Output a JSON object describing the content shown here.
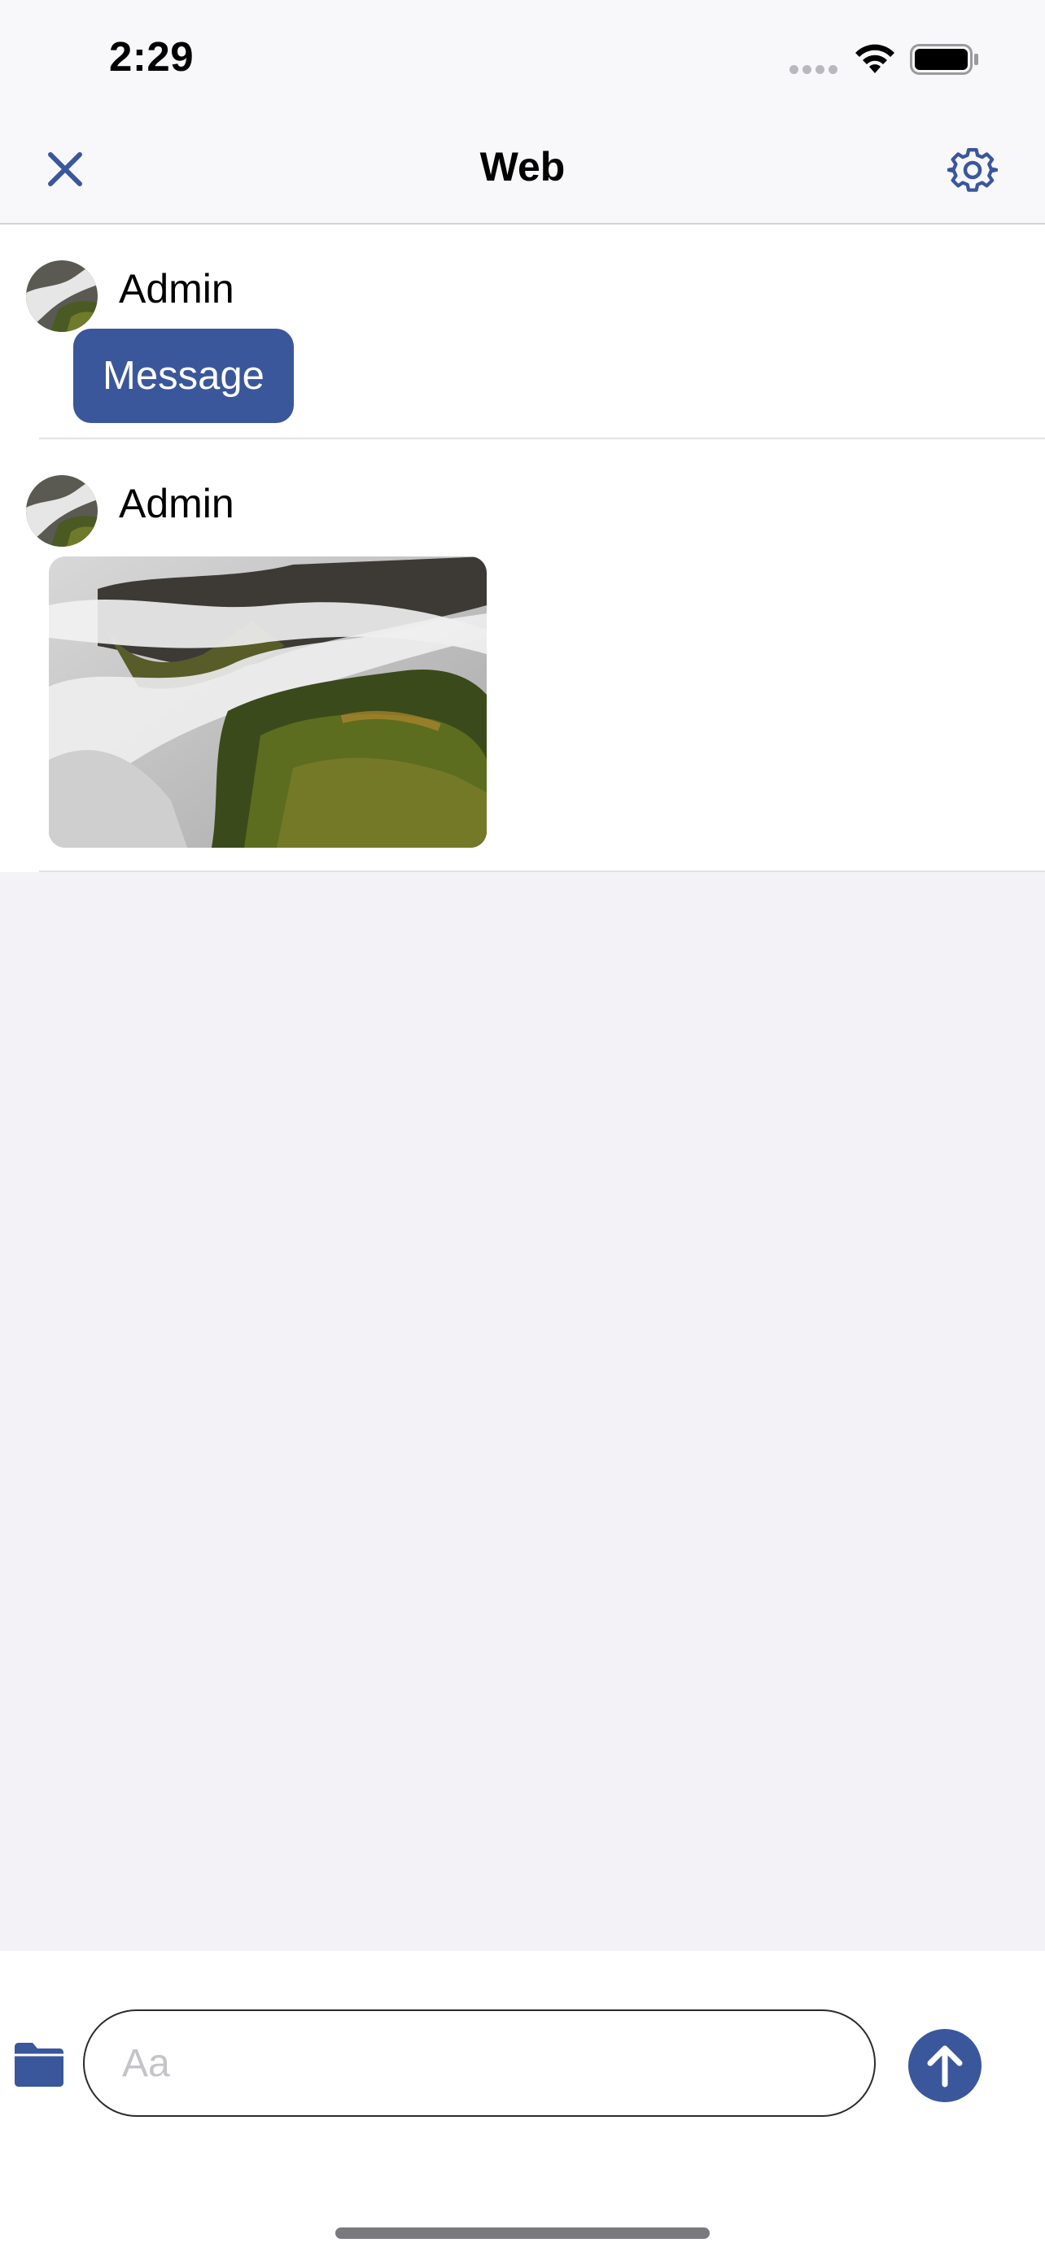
{
  "status_bar": {
    "time": "2:29"
  },
  "nav": {
    "title": "Web",
    "close_icon": "close-icon",
    "settings_icon": "gear-icon"
  },
  "messages": [
    {
      "sender": "Admin",
      "type": "text",
      "text": "Message"
    },
    {
      "sender": "Admin",
      "type": "image"
    }
  ],
  "compose": {
    "placeholder": "Aa",
    "attach_icon": "folder-icon",
    "send_icon": "arrow-up-icon"
  },
  "colors": {
    "accent": "#3a579b",
    "background": "#f2f2f7"
  }
}
